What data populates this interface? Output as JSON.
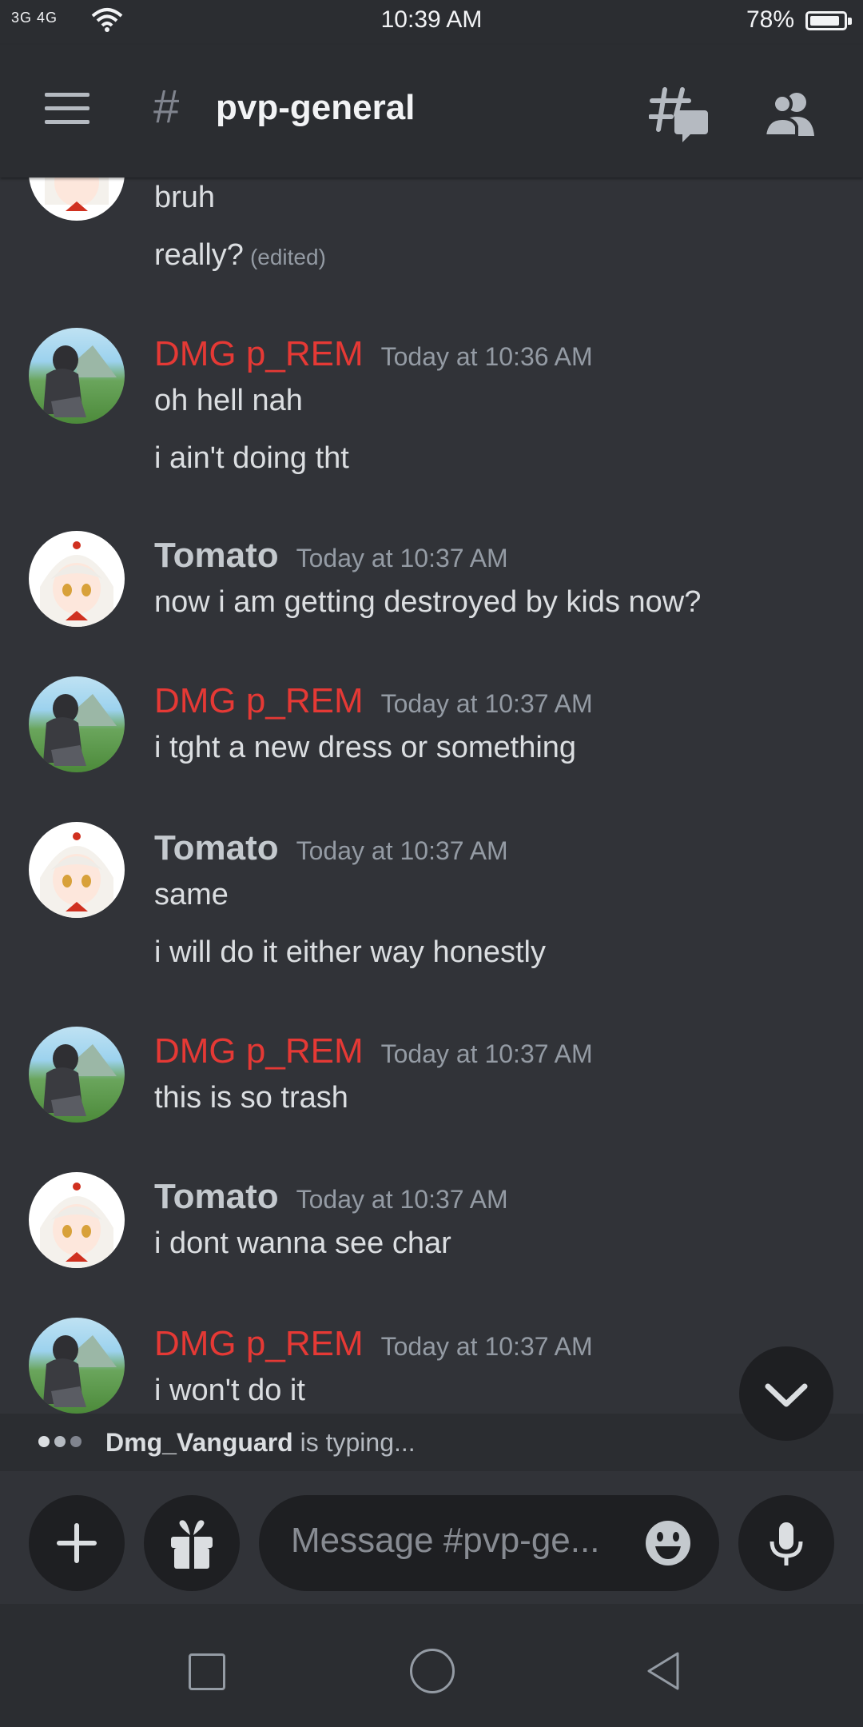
{
  "status_bar": {
    "signal": "3G 4G",
    "time": "10:39 AM",
    "battery": "78%",
    "battery_level": 0.78
  },
  "header": {
    "hash": "#",
    "channel": "pvp-general"
  },
  "messages": [
    {
      "author": "",
      "time": "",
      "lines": [
        "bruh",
        "really?"
      ],
      "edited_label": "(edited)"
    },
    {
      "author": "DMG p_REM",
      "time": "Today at 10:36 AM",
      "lines": [
        "oh hell nah",
        "i ain't doing tht"
      ]
    },
    {
      "author": "Tomato",
      "time": "Today at 10:37 AM",
      "lines": [
        "now i am getting destroyed by kids now?"
      ]
    },
    {
      "author": "DMG p_REM",
      "time": "Today at 10:37 AM",
      "lines": [
        "i tght a new dress or something"
      ]
    },
    {
      "author": "Tomato",
      "time": "Today at 10:37 AM",
      "lines": [
        "same",
        "i will do it either way honestly"
      ]
    },
    {
      "author": "DMG p_REM",
      "time": "Today at 10:37 AM",
      "lines": [
        "this is so trash"
      ]
    },
    {
      "author": "Tomato",
      "time": "Today at 10:37 AM",
      "lines": [
        "i dont wanna see char"
      ]
    },
    {
      "author": "DMG p_REM",
      "time": "Today at 10:37 AM",
      "lines": [
        "i won't do it"
      ]
    }
  ],
  "typing": {
    "user": "Dmg_Vanguard",
    "suffix": "is typing..."
  },
  "composer": {
    "placeholder": "Message #pvp-ge..."
  },
  "colors": {
    "background": "#313338",
    "bar": "#2b2d31",
    "dmg_name": "#e53935",
    "tomato_name": "#c4c9ce"
  }
}
